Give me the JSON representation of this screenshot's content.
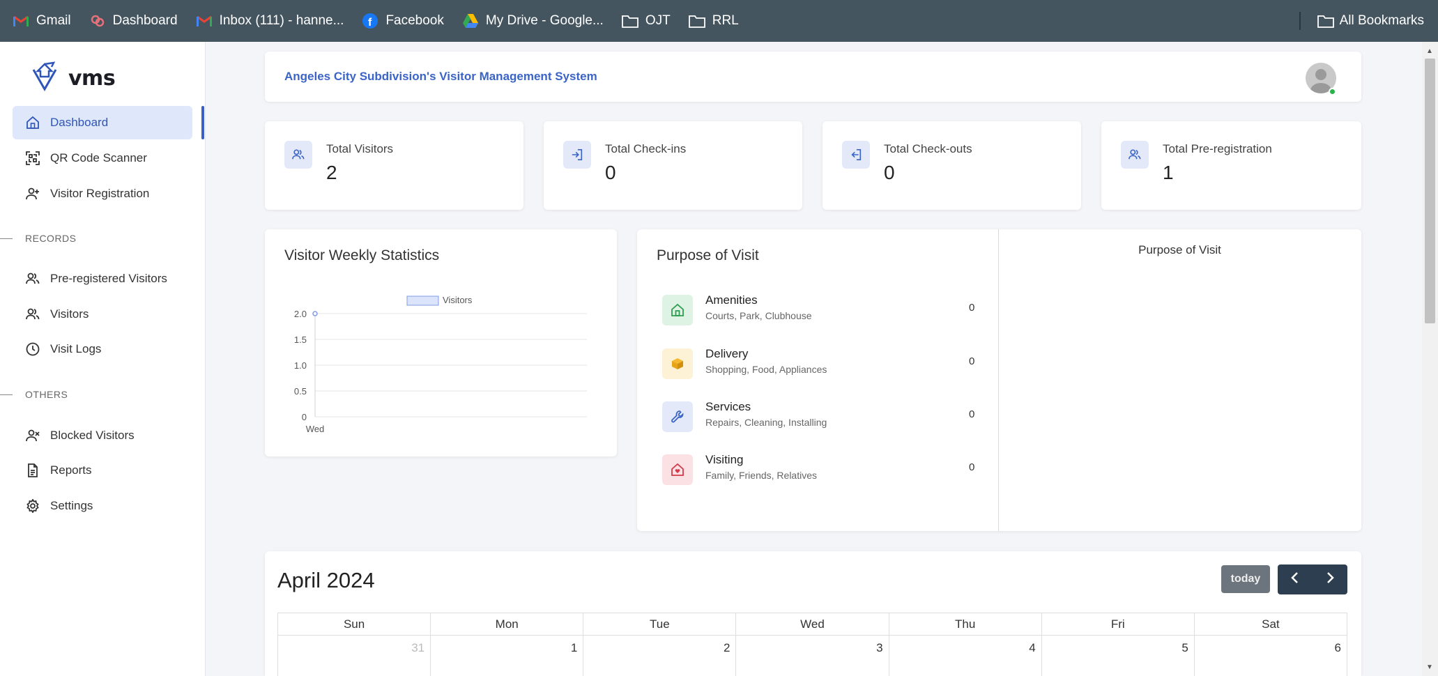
{
  "bookmarks": {
    "items": [
      {
        "label": "Gmail",
        "icon": "gmail-icon"
      },
      {
        "label": "Dashboard",
        "icon": "dashboard-site-icon"
      },
      {
        "label": "Inbox (111) - hanne...",
        "icon": "gmail-icon"
      },
      {
        "label": "Facebook",
        "icon": "facebook-icon"
      },
      {
        "label": "My Drive - Google...",
        "icon": "google-drive-icon"
      },
      {
        "label": "OJT",
        "icon": "folder-icon"
      },
      {
        "label": "RRL",
        "icon": "folder-icon"
      }
    ],
    "all_bookmarks": "All Bookmarks"
  },
  "sidebar": {
    "logo_text": "vms",
    "items": [
      {
        "label": "Dashboard",
        "icon": "home-icon"
      },
      {
        "label": "QR Code Scanner",
        "icon": "qr-scan-icon"
      },
      {
        "label": "Visitor Registration",
        "icon": "user-plus-icon"
      },
      {
        "label": "Pre-registered Visitors",
        "icon": "users-icon"
      },
      {
        "label": "Visitors",
        "icon": "users-icon"
      },
      {
        "label": "Visit Logs",
        "icon": "clock-icon"
      },
      {
        "label": "Blocked Visitors",
        "icon": "user-x-icon"
      },
      {
        "label": "Reports",
        "icon": "document-icon"
      },
      {
        "label": "Settings",
        "icon": "gear-icon"
      }
    ],
    "sections": {
      "records": "RECORDS",
      "others": "OTHERS"
    }
  },
  "header": {
    "title": "Angeles City Subdivision's Visitor Management System"
  },
  "stats": [
    {
      "label": "Total Visitors",
      "value": "2",
      "icon": "users-icon"
    },
    {
      "label": "Total Check-ins",
      "value": "0",
      "icon": "sign-in-icon"
    },
    {
      "label": "Total Check-outs",
      "value": "0",
      "icon": "sign-out-icon"
    },
    {
      "label": "Total Pre-registration",
      "value": "1",
      "icon": "users-icon"
    }
  ],
  "weekly": {
    "title": "Visitor Weekly Statistics"
  },
  "chart_data": {
    "type": "line",
    "categories": [
      "Wed"
    ],
    "series": [
      {
        "name": "Visitors",
        "values": [
          2
        ]
      }
    ],
    "ylim": [
      0,
      2
    ],
    "yticks": [
      "2.0",
      "1.5",
      "1.0",
      "0.5",
      "0"
    ],
    "legend": "top",
    "grid": true
  },
  "purpose": {
    "title": "Purpose of Visit",
    "side_title": "Purpose of Visit",
    "items": [
      {
        "name": "Amenities",
        "sub": "Courts, Park, Clubhouse",
        "count": "0",
        "icon": "house-icon",
        "color": "#2e9e4f",
        "bg": "#dff3e4"
      },
      {
        "name": "Delivery",
        "sub": "Shopping, Food, Appliances",
        "count": "0",
        "icon": "box-icon",
        "color": "#e7a416",
        "bg": "#fdf1d6"
      },
      {
        "name": "Services",
        "sub": "Repairs, Cleaning, Installing",
        "count": "0",
        "icon": "wrench-icon",
        "color": "#3b64c7",
        "bg": "#e3e9f8"
      },
      {
        "name": "Visiting",
        "sub": "Family, Friends, Relatives",
        "count": "0",
        "icon": "home-heart-icon",
        "color": "#d33a4a",
        "bg": "#fbe1e4"
      }
    ]
  },
  "calendar": {
    "title": "April 2024",
    "today_label": "today",
    "weekdays": [
      "Sun",
      "Mon",
      "Tue",
      "Wed",
      "Thu",
      "Fri",
      "Sat"
    ],
    "days": [
      "31",
      "1",
      "2",
      "3",
      "4",
      "5",
      "6"
    ]
  },
  "colors": {
    "accent": "#3b64c7",
    "bookmark_bar": "#455560",
    "nav_active_bg": "#dfe7fa"
  }
}
